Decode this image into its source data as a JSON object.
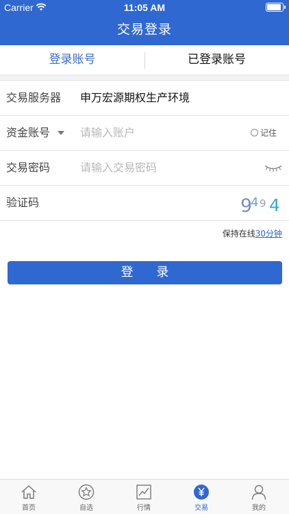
{
  "status_bar": {
    "carrier": "Carrier",
    "time": "11:05 AM"
  },
  "header": {
    "title": "交易登录"
  },
  "tabs": [
    {
      "label": "登录账号",
      "active": true
    },
    {
      "label": "已登录账号",
      "active": false
    }
  ],
  "form": {
    "server": {
      "label": "交易服务器",
      "value": "申万宏源期权生产环境"
    },
    "account": {
      "label": "资金账号",
      "placeholder": "请输入账户",
      "remember_label": "记住"
    },
    "password": {
      "label": "交易密码",
      "placeholder": "请输入交易密码"
    },
    "captcha": {
      "label": "验证码",
      "code": "9494"
    }
  },
  "keep_online": {
    "prefix": "保持在线",
    "duration": "30分钟"
  },
  "login_button": "登 录",
  "tabbar": [
    {
      "label": "首页",
      "icon": "home-icon"
    },
    {
      "label": "自选",
      "icon": "star-icon"
    },
    {
      "label": "行情",
      "icon": "chart-icon"
    },
    {
      "label": "交易",
      "icon": "yuan-icon",
      "active": true
    },
    {
      "label": "我的",
      "icon": "user-icon"
    }
  ],
  "colors": {
    "brand": "#3068d1",
    "link": "#2f63c7"
  }
}
